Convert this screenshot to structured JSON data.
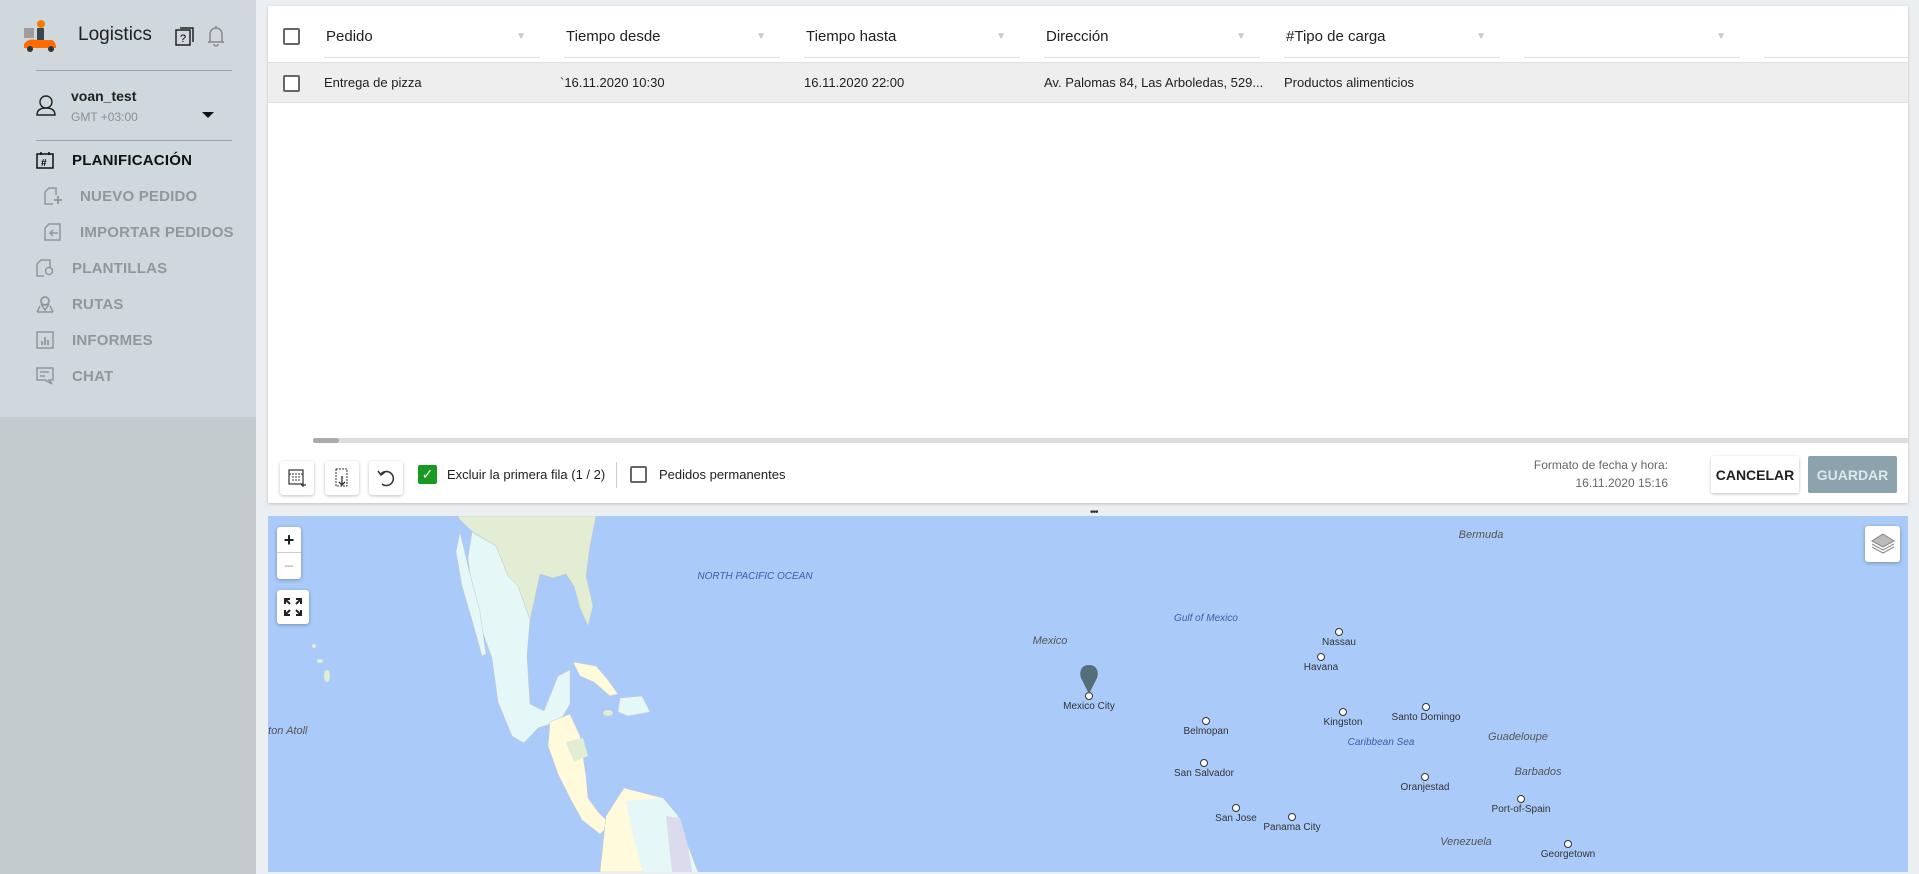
{
  "app": {
    "title": "Logistics",
    "logo": "scooter-courier-logo",
    "help_icon": "help-icon",
    "bell_icon": "bell-icon"
  },
  "user": {
    "name": "voan_test",
    "timezone": "GMT +03:00"
  },
  "nav": [
    {
      "label": "PLANIFICACIÓN",
      "icon": "calendar-icon",
      "active": true
    },
    {
      "label": "NUEVO PEDIDO",
      "icon": "new-document-icon",
      "sub": true
    },
    {
      "label": "IMPORTAR PEDIDOS",
      "icon": "import-icon",
      "sub": true
    },
    {
      "label": "PLANTILLAS",
      "icon": "template-icon"
    },
    {
      "label": "RUTAS",
      "icon": "route-icon"
    },
    {
      "label": "INFORMES",
      "icon": "chart-icon"
    },
    {
      "label": "CHAT",
      "icon": "chat-icon"
    }
  ],
  "table": {
    "columns": [
      "Pedido",
      "Tiempo desde",
      "Tiempo hasta",
      "Dirección",
      "#Tipo de carga",
      "",
      ""
    ],
    "rows": [
      [
        "Entrega de pizza",
        "`16.11.2020 10:30",
        "16.11.2020 22:00",
        "Av. Palomas 84, Las Arboledas, 529...",
        "Productos alimenticios"
      ]
    ]
  },
  "footer": {
    "exclude_first_row": {
      "label": "Excluir la primera fila (1 / 2)",
      "checked": true
    },
    "permanent": {
      "label": "Pedidos permanentes",
      "checked": false
    },
    "date_format_label": "Formato de fecha y hora:",
    "date_format_value": "16.11.2020 15:16",
    "cancel": "CANCELAR",
    "save": "GUARDAR"
  },
  "map": {
    "zoom_in": "+",
    "zoom_out": "−",
    "labels": {
      "north_pacific": "NORTH PACIFIC OCEAN",
      "gulf": "Gulf of Mexico",
      "mexico": "Mexico",
      "bermuda": "Bermuda",
      "johnston": "nston Atoll",
      "caribbean": "Caribbean  Sea",
      "guadeloupe": "Guadeloupe",
      "barbados": "Barbados",
      "venezuela": "Venezuela"
    },
    "cities": {
      "mexico_city": "Mexico City",
      "nassau": "Nassau",
      "havana": "Havana",
      "kingston": "Kingston",
      "santo_domingo": "Santo Domingo",
      "belmopan": "Belmopan",
      "san_salvador": "San Salvador",
      "oranjestad": "Oranjestad",
      "port_of_spain": "Port-of-Spain",
      "san_jose": "San Jose",
      "panama_city": "Panama City",
      "georgetown": "Georgetown"
    },
    "colors": {
      "water": "#aacbfa",
      "usa": "#e2edd3",
      "mexico": "#e6f7f7",
      "central": "#fffadc",
      "marker": "#546e7a"
    }
  }
}
